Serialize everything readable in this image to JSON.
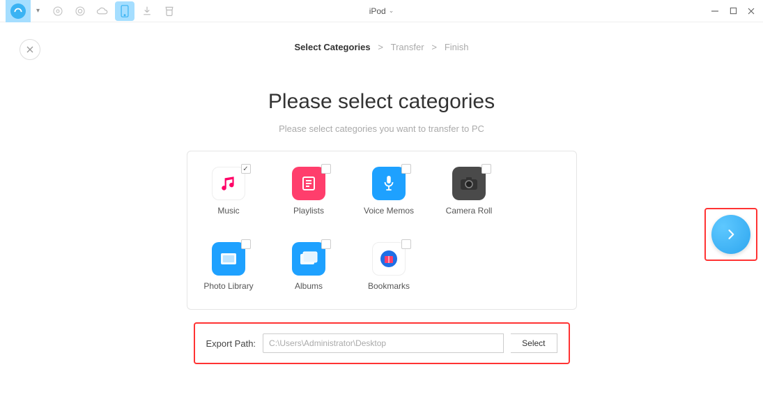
{
  "toolbar": {
    "device_label": "iPod"
  },
  "breadcrumb": {
    "step1": "Select Categories",
    "step2": "Transfer",
    "step3": "Finish",
    "sep": ">"
  },
  "page": {
    "title": "Please select categories",
    "subtitle": "Please select categories you want to transfer to PC"
  },
  "categories": [
    {
      "label": "Music",
      "checked": true
    },
    {
      "label": "Playlists",
      "checked": false
    },
    {
      "label": "Voice Memos",
      "checked": false
    },
    {
      "label": "Camera Roll",
      "checked": false
    },
    {
      "label": "Photo Library",
      "checked": false
    },
    {
      "label": "Albums",
      "checked": false
    },
    {
      "label": "Bookmarks",
      "checked": false
    }
  ],
  "export": {
    "label": "Export Path:",
    "path": "C:\\Users\\Administrator\\Desktop",
    "select_label": "Select"
  },
  "highlight_color": "#f33"
}
